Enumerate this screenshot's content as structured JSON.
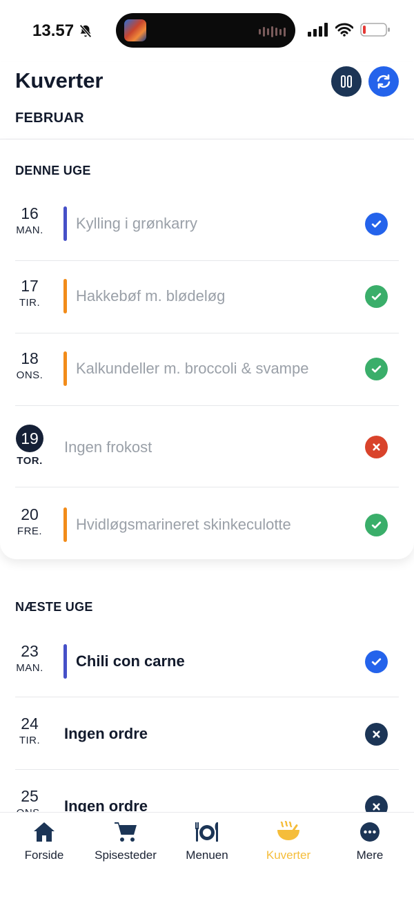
{
  "status_bar": {
    "time": "13.57"
  },
  "header": {
    "title": "Kuverter",
    "month": "FEBRUAR"
  },
  "colors": {
    "blue_bar": "#4650c8",
    "orange_bar": "#f28c1a",
    "blue_check": "#2463eb",
    "green_check": "#3aae6a",
    "red_x": "#d9432b",
    "navy_x": "#1c3556"
  },
  "this_week": {
    "title": "DENNE UGE",
    "days": [
      {
        "num": "16",
        "dow": "MAN.",
        "dish": "Kylling i grønkarry",
        "bar": "blue",
        "status": "check-blue"
      },
      {
        "num": "17",
        "dow": "TIR.",
        "dish": "Hakkebøf m. blødeløg",
        "bar": "orange",
        "status": "check-green"
      },
      {
        "num": "18",
        "dow": "ONS.",
        "dish": "Kalkundeller m. broccoli & svampe",
        "bar": "orange",
        "status": "check-green"
      },
      {
        "num": "19",
        "dow": "TOR.",
        "dish": "Ingen frokost",
        "bar": "none",
        "status": "x-red",
        "today": true
      },
      {
        "num": "20",
        "dow": "FRE.",
        "dish": "Hvidløgsmarineret skinkeculotte",
        "bar": "orange",
        "status": "check-green"
      }
    ]
  },
  "next_week": {
    "title": "NÆSTE UGE",
    "days": [
      {
        "num": "23",
        "dow": "MAN.",
        "dish": "Chili con carne",
        "bar": "blue",
        "status": "check-blue"
      },
      {
        "num": "24",
        "dow": "TIR.",
        "dish": "Ingen ordre",
        "bar": "none",
        "status": "x-navy"
      },
      {
        "num": "25",
        "dow": "ONS.",
        "dish": "Ingen ordre",
        "bar": "none",
        "status": "x-navy"
      }
    ]
  },
  "tabs": [
    {
      "label": "Forside",
      "icon": "home-icon",
      "active": false
    },
    {
      "label": "Spisesteder",
      "icon": "cart-icon",
      "active": false
    },
    {
      "label": "Menuen",
      "icon": "utensils-icon",
      "active": false
    },
    {
      "label": "Kuverter",
      "icon": "bowl-icon",
      "active": true
    },
    {
      "label": "Mere",
      "icon": "more-icon",
      "active": false
    }
  ]
}
